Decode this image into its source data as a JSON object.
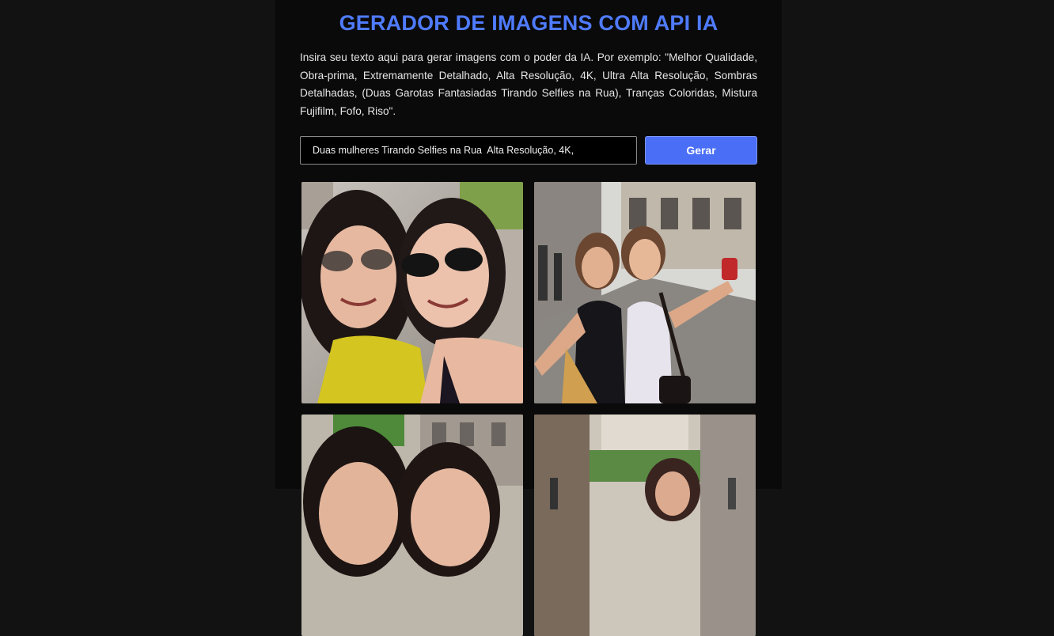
{
  "app": {
    "title": "GERADOR DE IMAGENS COM API IA",
    "description": "Insira seu texto aqui para gerar imagens com o poder da IA. Por exemplo: \"Melhor Qualidade, Obra-prima, Extremamente Detalhado, Alta Resolução, 4K, Ultra Alta Resolução, Sombras Detalhadas, (Duas Garotas Fantasiadas Tirando Selfies na Rua), Tranças Coloridas, Mistura Fujifilm, Fofo, Riso\"."
  },
  "form": {
    "prompt_value": "Duas mulheres Tirando Selfies na Rua  Alta Resolução, 4K,",
    "generate_label": "Gerar"
  },
  "colors": {
    "accent": "#4f7bff",
    "button": "#4a6ef5",
    "panel_bg": "#0a0a0a",
    "page_bg": "#121212"
  },
  "gallery": {
    "images": [
      {
        "subject": "two women selfie close-up, yellow top"
      },
      {
        "subject": "two women selfie on cobblestone street"
      },
      {
        "subject": "two women selfie on street, partially visible"
      },
      {
        "subject": "street scene with woman, partially visible"
      }
    ]
  }
}
